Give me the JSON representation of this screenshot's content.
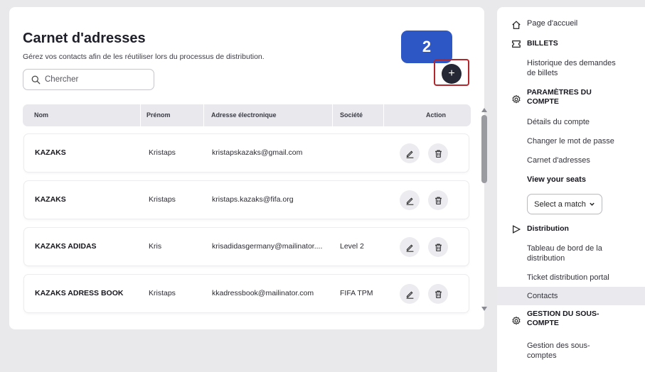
{
  "page": {
    "title": "Carnet d'adresses",
    "subtitle": "Gérez vos contacts afin de les réutiliser lors du processus de distribution.",
    "search_placeholder": "Chercher",
    "step_badge": "2",
    "add_label": "+"
  },
  "table": {
    "headers": [
      "Nom",
      "Prénom",
      "Adresse électronique",
      "Société",
      "Action"
    ],
    "rows": [
      {
        "name": "KAZAKS",
        "first": "Kristaps",
        "email": "kristapskazaks@gmail.com",
        "company": ""
      },
      {
        "name": "KAZAKS",
        "first": "Kristaps",
        "email": "kristaps.kazaks@fifa.org",
        "company": ""
      },
      {
        "name": "KAZAKS ADIDAS",
        "first": "Kris",
        "email": "krisadidasgermany@mailinator....",
        "company": "Level 2"
      },
      {
        "name": "KAZAKS ADRESS BOOK",
        "first": "Kristaps",
        "email": "kkadressbook@mailinator.com",
        "company": "FIFA TPM"
      }
    ]
  },
  "sidebar": {
    "home": "Page d'accueil",
    "billets": "BILLETS",
    "historique": "Historique des demandes de billets",
    "parametres": "PARAMÈTRES DU COMPTE",
    "details": "Détails du compte",
    "password": "Changer le mot de passe",
    "carnet": "Carnet d'adresses",
    "view_seats": "View your seats",
    "select_match": "Select a match",
    "distribution": "Distribution",
    "tableau": "Tableau de bord de la distribution",
    "portal": "Ticket distribution portal",
    "contacts": "Contacts",
    "gestion": "GESTION DU SOUS-COMPTE",
    "gestion_sub": "Gestion des sous-comptes"
  },
  "colors": {
    "badge": "#2e57c6",
    "add_button": "#262836",
    "highlight_outline": "#b3262c",
    "active_item": "#eaeaee"
  }
}
